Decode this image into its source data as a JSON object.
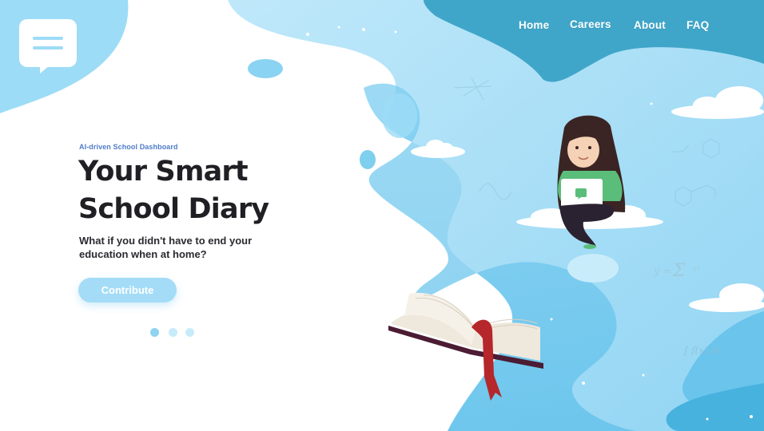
{
  "nav": {
    "items": [
      {
        "label": "Home"
      },
      {
        "label": "Careers"
      },
      {
        "label": "About"
      },
      {
        "label": "FAQ"
      }
    ]
  },
  "hero": {
    "eyebrow": "AI-driven School Dashboard",
    "headline_line1": "Your Smart",
    "headline_line2": "School Diary",
    "subtext": "What if you didn't have to end your education when at home?",
    "cta_label": "Contribute"
  },
  "carousel": {
    "slide_count": 3,
    "active_index": 0
  },
  "illustration": {
    "formula_sum": "y = Σ x²",
    "formula_integral": "∫ f(x) dx"
  },
  "colors": {
    "accent_blue": "#8fd2f1",
    "deep_blue": "#3fa6c9",
    "sky": "#c9ecfb",
    "text_dark": "#1f1f24",
    "eyebrow_blue": "#4f7cc9",
    "book_red": "#b5272b",
    "book_cover": "#4b1c33"
  },
  "icons": {
    "logo": "chat-bubble-menu-icon"
  }
}
